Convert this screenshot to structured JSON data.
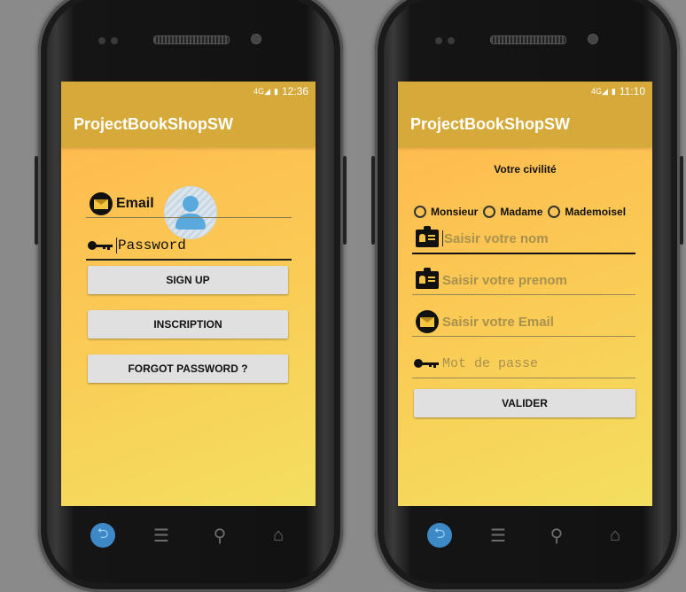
{
  "left": {
    "status_time": "12:36",
    "app_title": "ProjectBookShopSW",
    "email_label": "Email",
    "password_value": "Password",
    "signup_label": "SIGN UP",
    "inscription_label": "INSCRIPTION",
    "forgot_label": "FORGOT PASSWORD ?"
  },
  "right": {
    "status_time": "11:10",
    "app_title": "ProjectBookShopSW",
    "civility_title": "Votre civilité",
    "radio_options": [
      "Monsieur",
      "Madame",
      "Mademoisel"
    ],
    "nom_placeholder": "Saisir votre nom",
    "prenom_placeholder": "Saisir votre prenom",
    "email_placeholder": "Saisir votre Email",
    "password_placeholder": "Mot de passe",
    "valider_label": "VALIDER"
  },
  "status_icons": [
    "4g-icon",
    "battery-icon"
  ],
  "colors": {
    "appbar": "#d6aa3a",
    "screen_top": "#ffb74d",
    "screen_bottom": "#f3df5f",
    "button": "#e0e0e0",
    "nav_back": "#3d89c7"
  }
}
